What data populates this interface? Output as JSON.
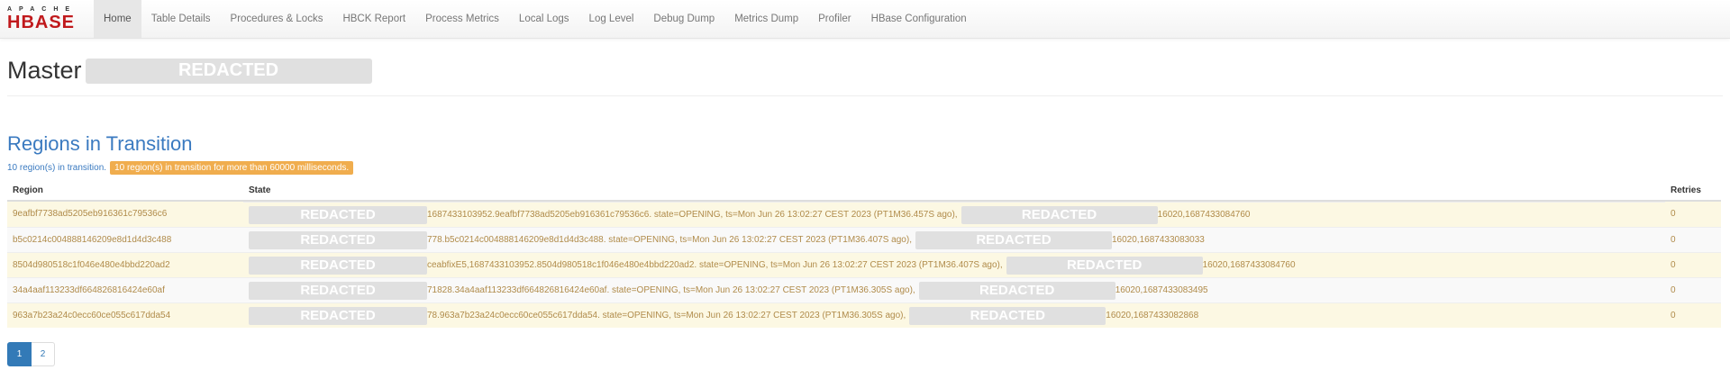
{
  "logo": {
    "top": "APACHE",
    "main": "HBASE"
  },
  "nav": [
    "Home",
    "Table Details",
    "Procedures & Locks",
    "HBCK Report",
    "Process Metrics",
    "Local Logs",
    "Log Level",
    "Debug Dump",
    "Metrics Dump",
    "Profiler",
    "HBase Configuration"
  ],
  "header": {
    "title": "Master",
    "redacted": "REDACTED"
  },
  "rit": {
    "title": "Regions in Transition",
    "count_text": "10 region(s) in transition.",
    "warning_text": "10 region(s) in transition for more than 60000 milliseconds.",
    "columns": {
      "region": "Region",
      "state": "State",
      "retries": "Retries"
    },
    "redacted": "REDACTED",
    "rows": [
      {
        "region": "9eafbf7738ad5205eb916361c79536c6",
        "state_mid": "1687433103952.9eafbf7738ad5205eb916361c79536c6. state=OPENING, ts=Mon Jun 26 13:02:27 CEST 2023 (PT1M36.457S ago),",
        "state_end": "16020,1687433084760",
        "retries": "0"
      },
      {
        "region": "b5c0214c004888146209e8d1d4d3c488",
        "state_mid": "778.b5c0214c004888146209e8d1d4d3c488. state=OPENING, ts=Mon Jun 26 13:02:27 CEST 2023 (PT1M36.407S ago),",
        "state_end": "16020,1687433083033",
        "retries": "0"
      },
      {
        "region": "8504d980518c1f046e480e4bbd220ad2",
        "state_mid": "ceabfixE5,1687433103952.8504d980518c1f046e480e4bbd220ad2. state=OPENING, ts=Mon Jun 26 13:02:27 CEST 2023 (PT1M36.407S ago),",
        "state_end": "16020,1687433084760",
        "retries": "0"
      },
      {
        "region": "34a4aaf113233df664826816424e60af",
        "state_mid": "71828.34a4aaf113233df664826816424e60af. state=OPENING, ts=Mon Jun 26 13:02:27 CEST 2023 (PT1M36.305S ago),",
        "state_end": "16020,1687433083495",
        "retries": "0"
      },
      {
        "region": "963a7b23a24c0ecc60ce055c617dda54",
        "state_mid": "78.963a7b23a24c0ecc60ce055c617dda54. state=OPENING, ts=Mon Jun 26 13:02:27 CEST 2023 (PT1M36.305S ago),",
        "state_end": "16020,1687433082868",
        "retries": "0"
      }
    ]
  },
  "pagination": {
    "pages": [
      "1",
      "2"
    ],
    "current": "1"
  },
  "colors": {
    "accent": "#3a7ac0",
    "warning": "#f0ad4e",
    "brand": "#c0191c"
  }
}
